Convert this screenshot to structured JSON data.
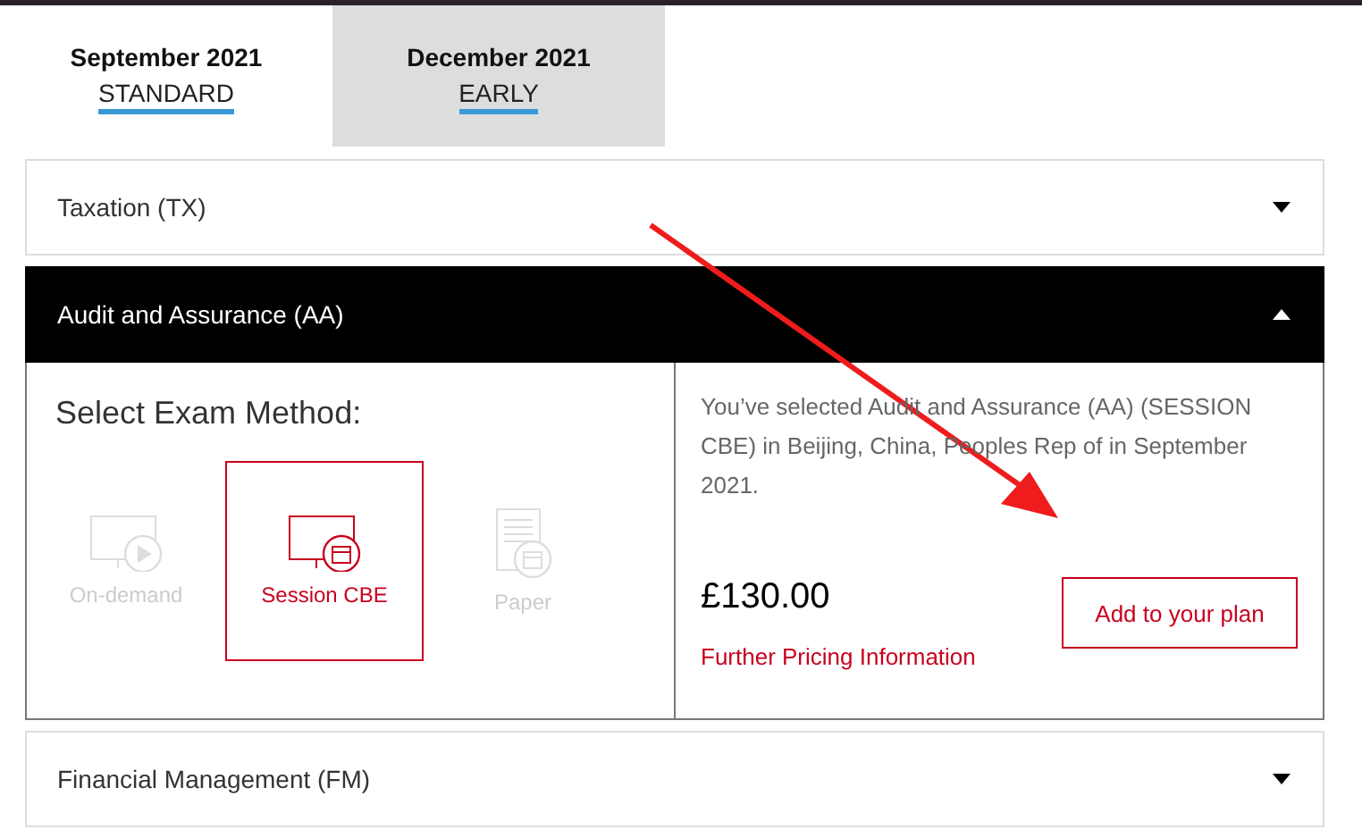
{
  "tabs": [
    {
      "month": "September 2021",
      "label": "STANDARD",
      "selected": true
    },
    {
      "month": "December 2021",
      "label": "EARLY",
      "selected": false
    }
  ],
  "subjects": [
    {
      "title": "Taxation (TX)",
      "expanded": false
    },
    {
      "title": "Audit and Assurance (AA)",
      "expanded": true,
      "method_heading": "Select Exam Method:",
      "methods": [
        {
          "kind": "ondemand",
          "label": "On-demand",
          "selected": false,
          "disabled": true
        },
        {
          "kind": "session",
          "label": "Session CBE",
          "selected": true,
          "disabled": false
        },
        {
          "kind": "paper",
          "label": "Paper",
          "selected": false,
          "disabled": true
        }
      ],
      "summary": "You’ve selected Audit and Assurance (AA) (SESSION CBE) in Beijing, China, Peoples Rep of in September 2021.",
      "price": "£130.00",
      "pricing_link": "Further Pricing Information",
      "add_button": "Add to your plan"
    },
    {
      "title": "Financial Management (FM)",
      "expanded": false
    }
  ],
  "annotation": {
    "kind": "arrow"
  }
}
